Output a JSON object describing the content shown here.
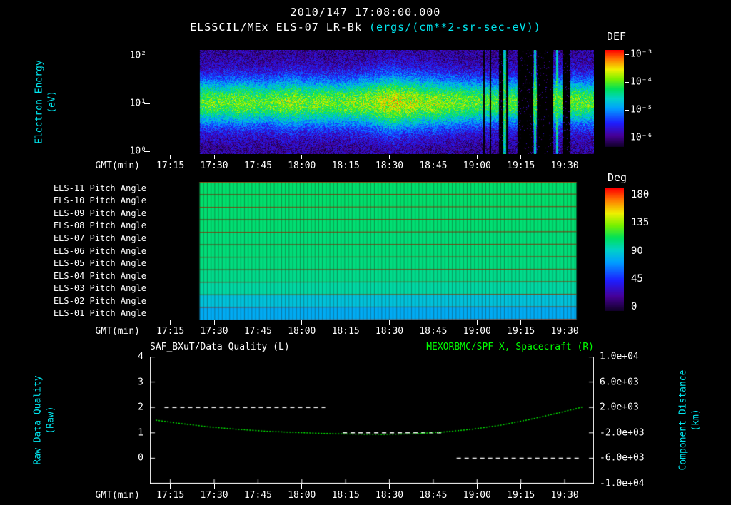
{
  "colors": {
    "background": "#000000",
    "text": "#ffffff",
    "axis_label": "#00e5ee",
    "right_series": "#00ff00"
  },
  "header": {
    "datetime": "2010/147 17:08:00.000",
    "instrument": "ELSSCIL/MEx ELS-07 LR-Bk",
    "units": "(ergs/(cm**2-sr-sec-eV))"
  },
  "time_axis": {
    "label": "GMT(min)",
    "start": "17:08",
    "end": "19:40",
    "start_min": 0,
    "end_min": 152,
    "ticks": [
      {
        "label": "17:15",
        "min": 7
      },
      {
        "label": "17:30",
        "min": 22
      },
      {
        "label": "17:45",
        "min": 37
      },
      {
        "label": "18:00",
        "min": 52
      },
      {
        "label": "18:15",
        "min": 67
      },
      {
        "label": "18:30",
        "min": 82
      },
      {
        "label": "18:45",
        "min": 97
      },
      {
        "label": "19:00",
        "min": 112
      },
      {
        "label": "19:15",
        "min": 127
      },
      {
        "label": "19:30",
        "min": 142
      }
    ]
  },
  "panel1": {
    "ylabel_line1": "Electron Energy",
    "ylabel_line2": "(eV)",
    "yticks": [
      "10²",
      "10¹",
      "10⁰"
    ],
    "colorbar_label": "DEF",
    "colorbar_ticks": [
      "10⁻³",
      "10⁻⁴",
      "10⁻⁵",
      "10⁻⁶"
    ]
  },
  "panel2": {
    "colorbar_label": "Deg",
    "colorbar_ticks": [
      "180",
      "135",
      "90",
      "45",
      "0"
    ]
  },
  "panel3": {
    "left_title": "SAF_BXuT/Data Quality (L)",
    "right_title": "MEXORBMC/SPF X, Spacecraft (R)",
    "left_label_line1": "Raw Data Quality",
    "left_label_line2": "(Raw)",
    "right_label_line1": "Component Distance",
    "right_label_line2": "(km)",
    "left_ticks": [
      "4",
      "3",
      "2",
      "1",
      "0"
    ],
    "right_ticks": [
      "1.0e+04",
      "6.0e+03",
      "2.0e+03",
      "-2.0e+03",
      "-6.0e+03",
      "-1.0e+04"
    ]
  },
  "chart_data": [
    {
      "type": "heatmap",
      "name": "electron-energy-spectrogram",
      "title": "ELSSCIL/MEx ELS-07 LR-Bk",
      "value_units": "ergs/(cm**2-sr-sec-eV)",
      "value_label": "DEF",
      "value_exponent_range": [
        -6,
        -3
      ],
      "xlabel": "GMT(min)",
      "ylabel": "Electron Energy (eV)",
      "yscale": "log",
      "ylim_ev": [
        1,
        130
      ],
      "x_start": "17:08",
      "x_end": "19:40",
      "data_start_min": 17,
      "band_center_ev": 10,
      "band_sigma_decades": 0.3,
      "time_profile": {
        "t_min": [
          17,
          20,
          25,
          30,
          35,
          40,
          45,
          50,
          53,
          58,
          63,
          68,
          72,
          76,
          80,
          84,
          87,
          90,
          93,
          97,
          100,
          104,
          108,
          112,
          116,
          120,
          124,
          128,
          132,
          136,
          139,
          142,
          145,
          148,
          152
        ],
        "brightness": [
          0.5,
          0.55,
          0.5,
          0.6,
          0.55,
          0.5,
          0.62,
          0.68,
          0.55,
          0.6,
          0.55,
          0.6,
          0.65,
          0.72,
          0.88,
          0.95,
          0.8,
          0.85,
          0.7,
          0.75,
          0.65,
          0.6,
          0.55,
          0.5,
          0.45,
          0.42,
          0.5,
          0.45,
          0.5,
          0.45,
          0.6,
          0.5,
          0.55,
          0.52,
          0.5
        ]
      },
      "dropouts_min": [
        [
          114.0,
          114.6
        ],
        [
          116.2,
          116.8
        ],
        [
          119.4,
          122.6
        ],
        [
          125.8,
          131.2
        ],
        [
          132.4,
          137.9
        ],
        [
          141.1,
          143.9
        ]
      ],
      "bright_columns_min": [
        121.3,
        131.7,
        139.3
      ]
    },
    {
      "type": "heatmap",
      "name": "pitch-angle-panels",
      "value_label": "Deg",
      "value_range": [
        0,
        180
      ],
      "data_start_min": 17,
      "data_end_min": 146,
      "rows": [
        {
          "label": "ELS-11 Pitch Angle",
          "mean_deg": 105
        },
        {
          "label": "ELS-10 Pitch Angle",
          "mean_deg": 105
        },
        {
          "label": "ELS-09 Pitch Angle",
          "mean_deg": 104
        },
        {
          "label": "ELS-08 Pitch Angle",
          "mean_deg": 104
        },
        {
          "label": "ELS-07 Pitch Angle",
          "mean_deg": 103
        },
        {
          "label": "ELS-06 Pitch Angle",
          "mean_deg": 103
        },
        {
          "label": "ELS-05 Pitch Angle",
          "mean_deg": 102
        },
        {
          "label": "ELS-04 Pitch Angle",
          "mean_deg": 100
        },
        {
          "label": "ELS-03 Pitch Angle",
          "mean_deg": 96
        },
        {
          "label": "ELS-02 Pitch Angle",
          "mean_deg": 84
        },
        {
          "label": "ELS-01 Pitch Angle",
          "mean_deg": 76
        }
      ]
    },
    {
      "type": "line",
      "name": "data-quality-and-spacecraft-distance",
      "left_axis": {
        "label": "Raw Data Quality (Raw)",
        "range": [
          -1,
          4
        ],
        "ticks": [
          4,
          3,
          2,
          1,
          0
        ]
      },
      "right_axis": {
        "label": "Component Distance (km)",
        "range": [
          -10000,
          10000
        ],
        "ticks": [
          10000,
          6000,
          2000,
          -2000,
          -6000,
          -10000
        ]
      },
      "series": [
        {
          "name": "SAF_BXuT/Data Quality (L)",
          "axis": "left",
          "color": "#ffffff",
          "style": "dashed",
          "segments": [
            {
              "value": 2,
              "t0_min": 5,
              "t1_min": 60
            },
            {
              "value": 1,
              "t0_min": 66,
              "t1_min": 100
            },
            {
              "value": 0,
              "t0_min": 105,
              "t1_min": 147
            }
          ]
        },
        {
          "name": "MEXORBMC/SPF X, Spacecraft (R)",
          "axis": "right",
          "color": "#00ff00",
          "style": "dotted",
          "t_min": [
            2,
            10,
            20,
            30,
            40,
            50,
            60,
            70,
            80,
            90,
            100,
            110,
            120,
            130,
            140,
            148
          ],
          "km": [
            0,
            -500,
            -1050,
            -1450,
            -1750,
            -1950,
            -2100,
            -2200,
            -2250,
            -2150,
            -1900,
            -1450,
            -800,
            100,
            1150,
            2050
          ]
        }
      ]
    }
  ]
}
